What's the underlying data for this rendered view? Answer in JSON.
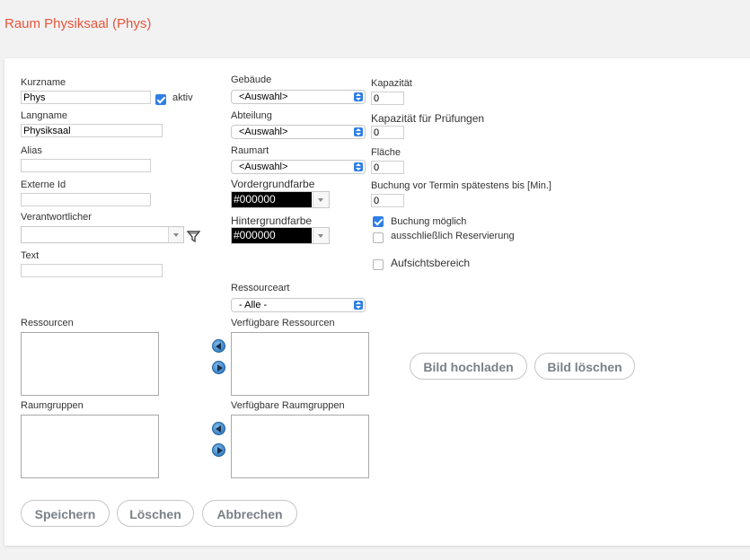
{
  "page": {
    "title": "Raum Physiksaal (Phys)"
  },
  "col1": {
    "kurzname_label": "Kurzname",
    "kurzname_value": "Phys",
    "aktiv_label": "aktiv",
    "aktiv_checked": true,
    "langname_label": "Langname",
    "langname_value": "Physiksaal",
    "alias_label": "Alias",
    "alias_value": "",
    "externe_id_label": "Externe Id",
    "externe_id_value": "",
    "verantwortlicher_label": "Verantwortlicher",
    "verantwortlicher_value": "",
    "text_label": "Text",
    "text_value": "",
    "ressourcen_label": "Ressourcen",
    "raumgruppen_label": "Raumgruppen"
  },
  "col2": {
    "gebaeude_label": "Gebäude",
    "gebaeude_value": "<Auswahl>",
    "abteilung_label": "Abteilung",
    "abteilung_value": "<Auswahl>",
    "raumart_label": "Raumart",
    "raumart_value": "<Auswahl>",
    "vordergrundfarbe_label": "Vordergrundfarbe",
    "vordergrundfarbe_value": "#000000",
    "hintergrundfarbe_label": "Hintergrundfarbe",
    "hintergrundfarbe_value": "#000000",
    "ressourceart_label": "Ressourceart",
    "ressourceart_value": "- Alle -",
    "verfuegbare_ressourcen_label": "Verfügbare Ressourcen",
    "verfuegbare_raumgruppen_label": "Verfügbare Raumgruppen"
  },
  "col3": {
    "kapazitaet_label": "Kapazität",
    "kapazitaet_value": "0",
    "kapazitaet_pruefungen_label": "Kapazität für Prüfungen",
    "kapazitaet_pruefungen_value": "0",
    "flaeche_label": "Fläche",
    "flaeche_value": "0",
    "buchung_vor_termin_label": "Buchung vor Termin spätestens bis [Min.]",
    "buchung_vor_termin_value": "0",
    "buchung_moeglich_label": "Buchung möglich",
    "buchung_moeglich_checked": true,
    "reservierung_label": "ausschließlich Reservierung",
    "reservierung_checked": false,
    "aufsichtsbereich_label": "Aufsichtsbereich",
    "aufsichtsbereich_checked": false
  },
  "image_buttons": {
    "upload_label": "Bild hochladen",
    "delete_label": "Bild löschen"
  },
  "footer": {
    "save_label": "Speichern",
    "delete_label": "Löschen",
    "cancel_label": "Abbrechen"
  },
  "colors": {
    "title": "#e8563a",
    "accent": "#2f7ee6"
  }
}
